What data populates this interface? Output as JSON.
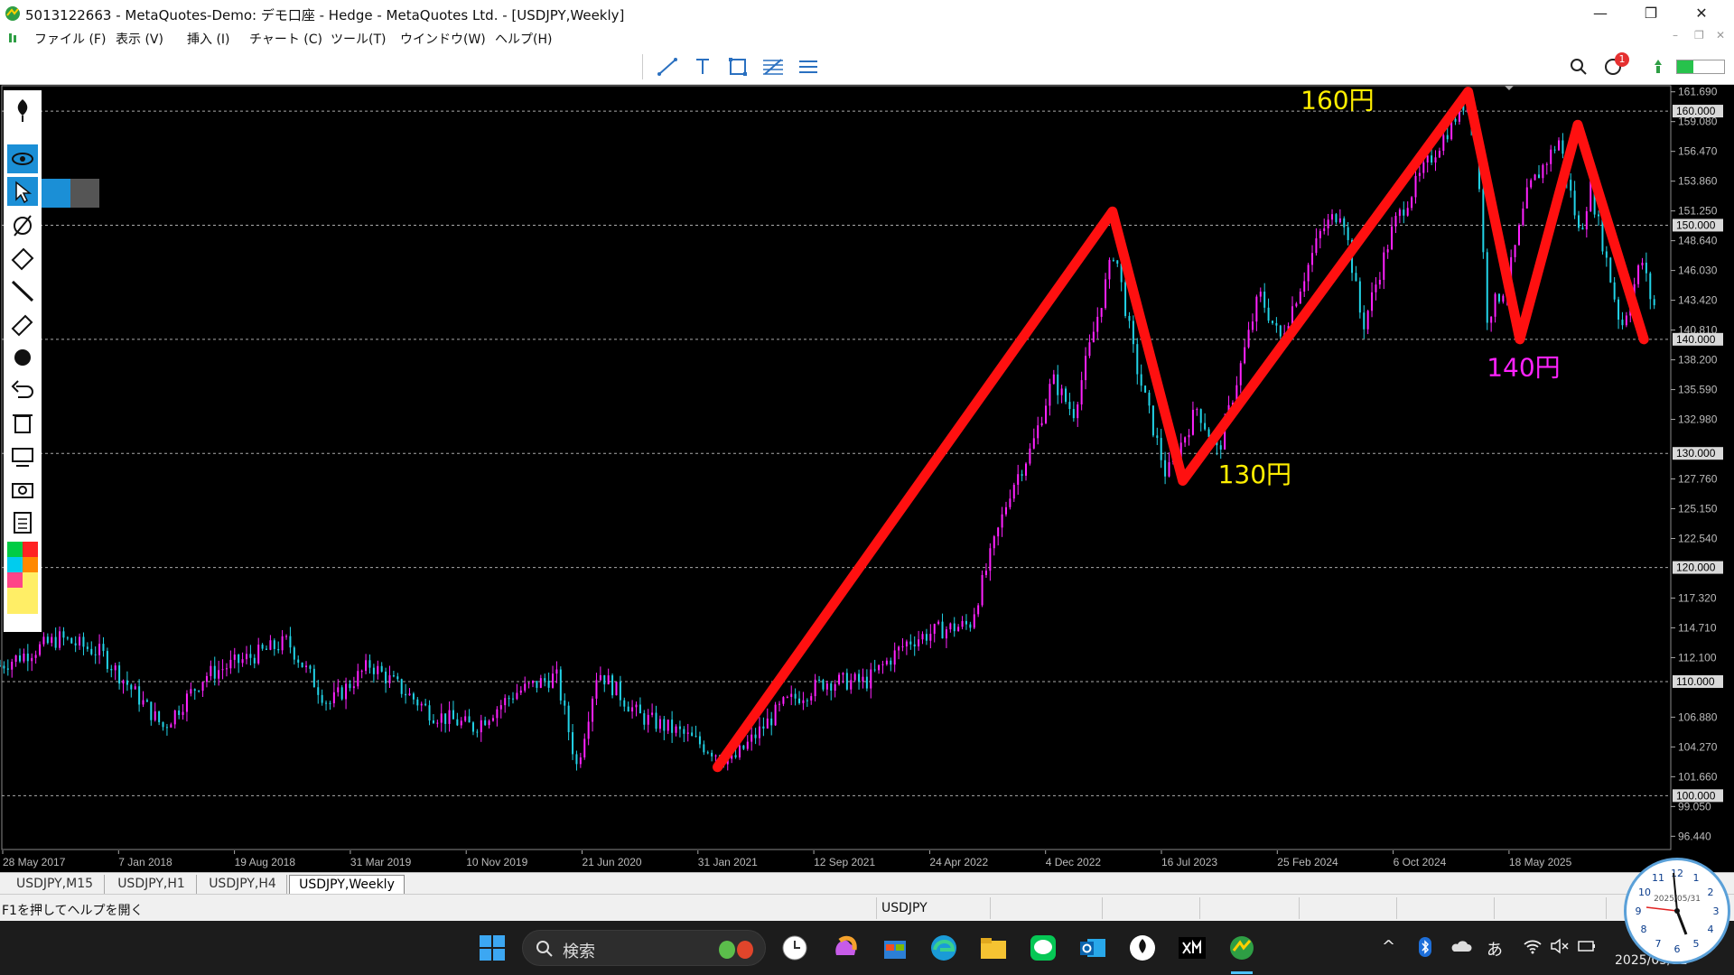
{
  "window": {
    "title": "5013122663 - MetaQuotes-Demo: デモ口座 - Hedge - MetaQuotes Ltd. - [USDJPY,Weekly]",
    "controls": [
      "—",
      "❐",
      "✕"
    ]
  },
  "menu": {
    "items": [
      "ファイル (F)",
      "表示 (V)",
      "挿入 (I)",
      "チャート (C)",
      "ツール(T)",
      "ウインドウ(W)",
      "ヘルプ(H)"
    ],
    "doc_controls": [
      "–",
      "❐",
      "✕"
    ]
  },
  "toolbar": {
    "icons": [
      "trendline-icon",
      "text-icon",
      "rectangle-icon",
      "fibonacci-icon",
      "channel-icon"
    ],
    "notification_count": "1",
    "right_icons": [
      "search-icon",
      "notifications-icon",
      "signal-icon",
      "connection-bar-icon"
    ]
  },
  "left_tools": [
    "pen-icon",
    "eye-icon",
    "cursor-icon",
    "compass-icon",
    "eraser-icon",
    "line-icon",
    "highlighter-icon",
    "dot-icon",
    "undo-icon",
    "trash-icon",
    "projector-icon",
    "camera-icon",
    "clipboard-icon"
  ],
  "palette": [
    "#00cc44",
    "#ff2222",
    "#00ccee",
    "#ff8800",
    "#ff4488",
    "#ffee66"
  ],
  "chart_data": {
    "type": "candlestick",
    "symbol": "USDJPY",
    "timeframe": "Weekly",
    "ylim": [
      95.2,
      162.3
    ],
    "y_ticks": [
      "161.690",
      "159.080",
      "156.470",
      "153.860",
      "151.250",
      "148.640",
      "146.030",
      "143.420",
      "140.810",
      "138.200",
      "135.590",
      "132.980",
      "127.760",
      "125.150",
      "122.540",
      "117.320",
      "114.710",
      "112.100",
      "106.880",
      "104.270",
      "101.660",
      "99.050",
      "96.440"
    ],
    "level_lines": [
      160,
      150,
      140,
      130,
      120,
      110,
      100
    ],
    "level_labels": [
      "160.000",
      "150.000",
      "140.000",
      "130.000",
      "120.000",
      "110.000",
      "100.000"
    ],
    "x_labels": [
      "28 May 2017",
      "7 Jan 2018",
      "19 Aug 2018",
      "31 Mar 2019",
      "10 Nov 2019",
      "21 Jun 2020",
      "31 Jan 2021",
      "12 Sep 2021",
      "24 Apr 2022",
      "4 Dec 2022",
      "16 Jul 2023",
      "25 Feb 2024",
      "6 Oct 2024",
      "18 May 2025"
    ],
    "price_path": [
      [
        2017.41,
        111.4
      ],
      [
        2017.7,
        113.8
      ],
      [
        2017.9,
        112.5
      ],
      [
        2018.2,
        106.0
      ],
      [
        2018.4,
        110.5
      ],
      [
        2018.8,
        113.5
      ],
      [
        2019.0,
        108.0
      ],
      [
        2019.2,
        111.5
      ],
      [
        2019.5,
        107.2
      ],
      [
        2019.7,
        106.0
      ],
      [
        2019.9,
        109.0
      ],
      [
        2020.1,
        110.5
      ],
      [
        2020.2,
        102.5
      ],
      [
        2020.3,
        111.0
      ],
      [
        2020.5,
        107.0
      ],
      [
        2020.7,
        105.5
      ],
      [
        2020.85,
        104.0
      ],
      [
        2020.95,
        103.0
      ],
      [
        2021.2,
        108.0
      ],
      [
        2021.4,
        110.0
      ],
      [
        2021.6,
        110.0
      ],
      [
        2021.8,
        113.5
      ],
      [
        2021.95,
        114.5
      ],
      [
        2022.1,
        115.0
      ],
      [
        2022.3,
        127.0
      ],
      [
        2022.4,
        130.5
      ],
      [
        2022.5,
        136.5
      ],
      [
        2022.6,
        133.5
      ],
      [
        2022.8,
        148.0
      ],
      [
        2022.9,
        138.0
      ],
      [
        2023.05,
        128.0
      ],
      [
        2023.2,
        134.0
      ],
      [
        2023.3,
        130.0
      ],
      [
        2023.5,
        144.0
      ],
      [
        2023.6,
        140.0
      ],
      [
        2023.8,
        149.5
      ],
      [
        2023.9,
        151.5
      ],
      [
        2024.0,
        141.0
      ],
      [
        2024.15,
        150.0
      ],
      [
        2024.3,
        155.0
      ],
      [
        2024.5,
        161.0
      ],
      [
        2024.55,
        158.0
      ],
      [
        2024.6,
        142.0
      ],
      [
        2024.7,
        145.0
      ],
      [
        2024.8,
        153.0
      ],
      [
        2024.95,
        157.5
      ],
      [
        2025.05,
        149.0
      ],
      [
        2025.1,
        153.5
      ],
      [
        2025.25,
        141.0
      ],
      [
        2025.35,
        147.0
      ],
      [
        2025.4,
        143.0
      ]
    ],
    "overlay_zigzag": [
      [
        2020.88,
        102.5
      ],
      [
        2022.79,
        151.2
      ],
      [
        2023.13,
        127.6
      ],
      [
        2024.51,
        161.7
      ],
      [
        2024.76,
        140.0
      ],
      [
        2025.04,
        158.8
      ],
      [
        2025.36,
        140.0
      ]
    ],
    "annotations": [
      {
        "text": "160円",
        "color": "#ffee00",
        "x": 2023.7,
        "y": 160.2
      },
      {
        "text": "140円",
        "color": "#ff22ff",
        "x": 2024.6,
        "y": 136.8
      },
      {
        "text": "130円",
        "color": "#ffee00",
        "x": 2023.3,
        "y": 127.4
      }
    ],
    "bull_color": "#ff22ff",
    "bear_color": "#22d4e8",
    "overlay_color": "#ff1010"
  },
  "tabs": [
    "USDJPY,M15",
    "USDJPY,H1",
    "USDJPY,H4",
    "USDJPY,Weekly"
  ],
  "status": {
    "help": "F1を押してヘルプを開く",
    "symbol": "USDJPY"
  },
  "taskbar": {
    "search_label": "検索",
    "apps": [
      "windows-start-icon",
      "clock-app-icon",
      "copilot-icon",
      "store-icon",
      "edge-icon",
      "explorer-icon",
      "line-app-icon",
      "outlook-icon",
      "pen-app-icon",
      "xm-app-icon",
      "metatrader-icon"
    ],
    "tray_ime": "あ",
    "date": "2025/05/31"
  },
  "clock_widget": {
    "date": "2025/05/31"
  }
}
